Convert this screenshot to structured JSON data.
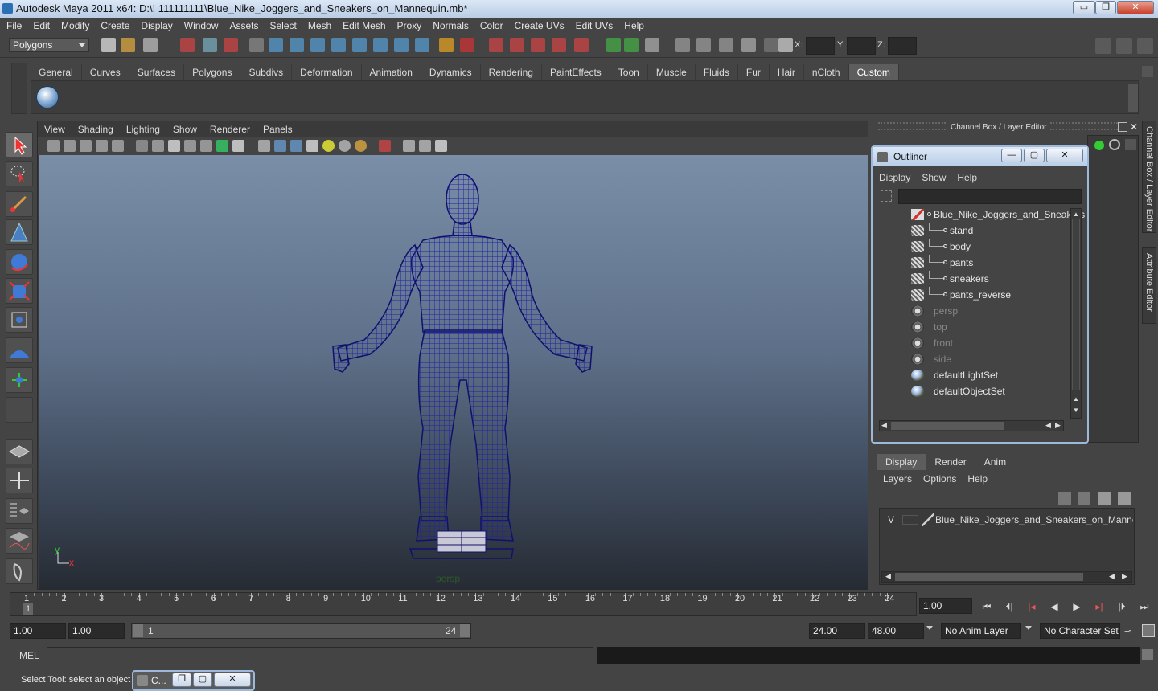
{
  "window": {
    "title": "Autodesk Maya 2011 x64: D:\\! 111111111\\Blue_Nike_Joggers_and_Sneakers_on_Mannequin.mb*",
    "minimize": "▭",
    "restore": "❐",
    "close": "✕"
  },
  "menubar": [
    "File",
    "Edit",
    "Modify",
    "Create",
    "Display",
    "Window",
    "Assets",
    "Select",
    "Mesh",
    "Edit Mesh",
    "Proxy",
    "Normals",
    "Color",
    "Create UVs",
    "Edit UVs",
    "Help"
  ],
  "statusline": {
    "menuset": "Polygons",
    "x_label": "X:",
    "y_label": "Y:",
    "z_label": "Z:"
  },
  "shelf": {
    "tabs": [
      "General",
      "Curves",
      "Surfaces",
      "Polygons",
      "Subdivs",
      "Deformation",
      "Animation",
      "Dynamics",
      "Rendering",
      "PaintEffects",
      "Toon",
      "Muscle",
      "Fluids",
      "Fur",
      "Hair",
      "nCloth",
      "Custom"
    ],
    "active_tab": "Custom"
  },
  "viewport": {
    "menus": [
      "View",
      "Shading",
      "Lighting",
      "Show",
      "Renderer",
      "Panels"
    ],
    "camera_label": "persp",
    "axis_y": "y",
    "axis_x": "x",
    "wire_color": "#1a1a8c"
  },
  "channel_box": {
    "header": "Channel Box / Layer Editor",
    "side_tab_1": "Channel Box / Layer Editor",
    "side_tab_2": "Attribute Editor"
  },
  "outliner": {
    "title": "Outliner",
    "btn_min": "—",
    "btn_max": "▢",
    "btn_close": "✕",
    "menus": [
      "Display",
      "Show",
      "Help"
    ],
    "items": [
      {
        "label": "Blue_Nike_Joggers_and_Sneakers",
        "icon": "group-icon",
        "dim": false,
        "child": false
      },
      {
        "label": "stand",
        "icon": "mesh-icon",
        "dim": false,
        "child": true
      },
      {
        "label": "body",
        "icon": "mesh-icon",
        "dim": false,
        "child": true
      },
      {
        "label": "pants",
        "icon": "mesh-icon",
        "dim": false,
        "child": true
      },
      {
        "label": "sneakers",
        "icon": "mesh-icon",
        "dim": false,
        "child": true
      },
      {
        "label": "pants_reverse",
        "icon": "mesh-icon",
        "dim": false,
        "child": true
      },
      {
        "label": "persp",
        "icon": "camera-icon",
        "dim": true,
        "child": false
      },
      {
        "label": "top",
        "icon": "camera-icon",
        "dim": true,
        "child": false
      },
      {
        "label": "front",
        "icon": "camera-icon",
        "dim": true,
        "child": false
      },
      {
        "label": "side",
        "icon": "camera-icon",
        "dim": true,
        "child": false
      },
      {
        "label": "defaultLightSet",
        "icon": "set-icon",
        "dim": false,
        "child": false
      },
      {
        "label": "defaultObjectSet",
        "icon": "set-icon",
        "dim": false,
        "child": false
      }
    ]
  },
  "layer_editor": {
    "tabs": [
      "Display",
      "Render",
      "Anim"
    ],
    "active_tab": "Display",
    "menus": [
      "Layers",
      "Options",
      "Help"
    ],
    "layer_visible": "V",
    "layer_name": "Blue_Nike_Joggers_and_Sneakers_on_Mannequin_"
  },
  "time_slider": {
    "frames": [
      "1",
      "2",
      "3",
      "4",
      "5",
      "6",
      "7",
      "8",
      "9",
      "10",
      "11",
      "12",
      "13",
      "14",
      "15",
      "16",
      "17",
      "18",
      "19",
      "20",
      "21",
      "22",
      "23",
      "24"
    ],
    "current_marker": "1",
    "current_time": "1.00"
  },
  "range_slider": {
    "start_time": "1.00",
    "playback_start": "1.00",
    "range_start": "1",
    "range_end": "24",
    "playback_end": "24.00",
    "end_time": "48.00",
    "anim_layer": "No Anim Layer",
    "character_set": "No Character Set"
  },
  "command_line": {
    "label": "MEL"
  },
  "help_line": {
    "text": "Select Tool: select an object",
    "mini_window": "C..."
  }
}
